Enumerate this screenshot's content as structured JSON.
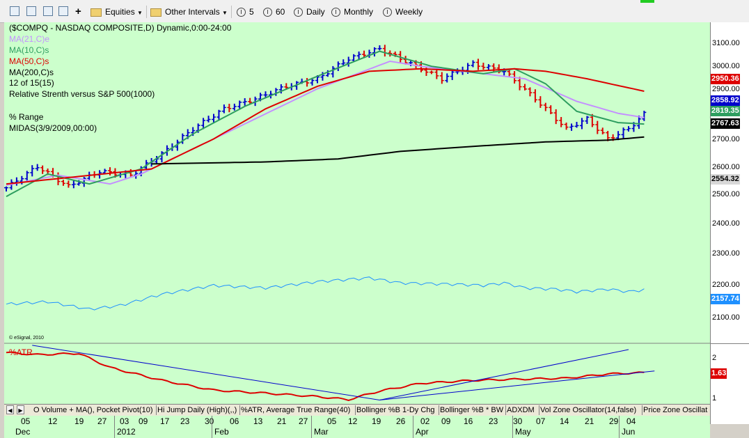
{
  "toolbar": {
    "equities_label": "Equities",
    "intervals_label": "Other Intervals",
    "interval_5": "5",
    "interval_60": "60",
    "daily": "Daily",
    "monthly": "Monthly",
    "weekly": "Weekly",
    "add_symbol": "+"
  },
  "legend": {
    "symbol_line": "($COMPQ - NASDAQ COMPOSITE,D) Dynamic,0:00-24:00",
    "ma21": "MA(21,C)e",
    "ma10": "MA(10,C)s",
    "ma50": "MA(50,C)s",
    "ma200": "MA(200,C)s",
    "page_info": "12 of 15(15)",
    "rs": "Relative Strenth versus S&P 500(1000)",
    "range": "% Range",
    "midas": "MIDAS(3/9/2009,00:00)",
    "esignal": "© eSignal, 2010",
    "atr": "%ATR"
  },
  "colors": {
    "plot_bg": "#ccffcc",
    "up_bar": "#0000cc",
    "down_bar": "#dd0000",
    "ma21": "#c490ff",
    "ma10": "#2e9e60",
    "ma50": "#dd0000",
    "ma200": "#000000",
    "rs": "#1e90ff",
    "trendline": "#0000cc"
  },
  "price_axis": {
    "ticks": [
      "3100.00",
      "3000.00",
      "2900.00",
      "2800.00",
      "2700.00",
      "2600.00",
      "2500.00",
      "2400.00",
      "2300.00",
      "2200.00",
      "2100.00"
    ],
    "tag_ma50": "2950.36",
    "tag_last": "2858.92",
    "tag_ma10": "2819.35",
    "tag_ma200": "2767.63",
    "tag_low": "2554.32",
    "tag_rs": "2157.74"
  },
  "atr_axis": {
    "ticks": [
      "2",
      "1"
    ],
    "tag_atr": "1.63"
  },
  "tabs": [
    "O Volume + MA(), Pocket Pivot(10)",
    "Hi Jump Daily (High)(,,)",
    "%ATR, Average True Range(40)",
    "Bollinger %B 1-Dy Chg",
    "Bollinger %B * BW",
    "ADXDM",
    "Vol Zone Oscillator(14,false)",
    "Price Zone Oscillat"
  ],
  "time_axis": {
    "days": [
      "05",
      "12",
      "19",
      "27",
      "03",
      "09",
      "17",
      "23",
      "30",
      "06",
      "13",
      "21",
      "27",
      "05",
      "12",
      "19",
      "26",
      "02",
      "09",
      "16",
      "23",
      "30",
      "07",
      "14",
      "21",
      "29",
      "04"
    ],
    "months": [
      "Dec",
      "2012",
      "Feb",
      "Mar",
      "Apr",
      "May",
      "Jun"
    ]
  },
  "chart_data": {
    "type": "line",
    "title": "($COMPQ - NASDAQ COMPOSITE,D) Dynamic,0:00-24:00",
    "ylim": [
      2030,
      3170
    ],
    "bar_count": 124,
    "price_series": {
      "name": "$COMPQ",
      "anchors_bar_index": [
        0,
        6,
        12,
        18,
        24,
        30,
        36,
        42,
        48,
        54,
        60,
        66,
        72,
        78,
        84,
        90,
        96,
        102,
        108,
        112,
        116,
        120,
        123
      ],
      "anchors_close": [
        2565,
        2650,
        2570,
        2630,
        2615,
        2700,
        2800,
        2880,
        2920,
        2970,
        3000,
        3080,
        3120,
        3060,
        3000,
        3060,
        3030,
        2920,
        2800,
        2840,
        2760,
        2800,
        2858.92
      ]
    },
    "series": [
      {
        "name": "MA(21,C)e",
        "bar_index": [
          0,
          10,
          20,
          26,
          40,
          60,
          74,
          80,
          92,
          100,
          110,
          118,
          123
        ],
        "values": [
          2575,
          2615,
          2580,
          2620,
          2760,
          2960,
          3070,
          3050,
          3020,
          3000,
          2910,
          2862,
          2845
        ]
      },
      {
        "name": "MA(10,C)s",
        "bar_index": [
          0,
          8,
          16,
          26,
          36,
          46,
          60,
          72,
          82,
          92,
          98,
          104,
          110,
          118,
          123
        ],
        "values": [
          2530,
          2620,
          2580,
          2640,
          2780,
          2890,
          3010,
          3110,
          3050,
          3020,
          3040,
          2980,
          2870,
          2825,
          2819.35
        ]
      },
      {
        "name": "MA(50,C)s",
        "bar_index": [
          0,
          14,
          28,
          40,
          50,
          60,
          70,
          80,
          90,
          98,
          104,
          112,
          123
        ],
        "values": [
          2580,
          2610,
          2640,
          2760,
          2880,
          2970,
          3030,
          3040,
          3030,
          3040,
          3030,
          3000,
          2950.36
        ]
      },
      {
        "name": "MA(200,C)s",
        "bar_index": [
          28,
          50,
          64,
          76,
          90,
          104,
          116,
          123
        ],
        "values": [
          2660,
          2668,
          2680,
          2710,
          2730,
          2748,
          2755,
          2767.63
        ]
      },
      {
        "name": "Relative Strenth versus S&P 500(1000)",
        "bar_index": [
          0,
          8,
          16,
          22,
          30,
          40,
          50,
          60,
          70,
          76,
          86,
          92,
          96,
          100,
          106,
          110,
          116,
          120,
          123
        ],
        "values": [
          2100,
          2110,
          2080,
          2095,
          2140,
          2175,
          2165,
          2190,
          2205,
          2185,
          2180,
          2175,
          2185,
          2165,
          2160,
          2150,
          2160,
          2150,
          2157.74
        ]
      }
    ],
    "atr_panel": {
      "name": "%ATR",
      "ylim": [
        0.9,
        2.3
      ],
      "bar_index": [
        0,
        6,
        14,
        20,
        30,
        40,
        50,
        60,
        66,
        72,
        80,
        90,
        100,
        108,
        116,
        123
      ],
      "values": [
        2.1,
        2.05,
        2.08,
        1.75,
        1.45,
        1.22,
        1.15,
        1.07,
        1.0,
        1.2,
        1.38,
        1.45,
        1.48,
        1.5,
        1.6,
        1.63
      ]
    },
    "trendlines": [
      {
        "panel": "atr",
        "from_bar": 5,
        "from_value": 2.27,
        "to_bar": 72,
        "to_value": 0.99
      },
      {
        "panel": "atr",
        "from_bar": 72,
        "from_value": 0.99,
        "to_bar": 120,
        "to_value": 2.17
      },
      {
        "panel": "atr",
        "from_bar": 72,
        "from_value": 0.99,
        "to_bar": 125,
        "to_value": 1.67
      }
    ]
  }
}
